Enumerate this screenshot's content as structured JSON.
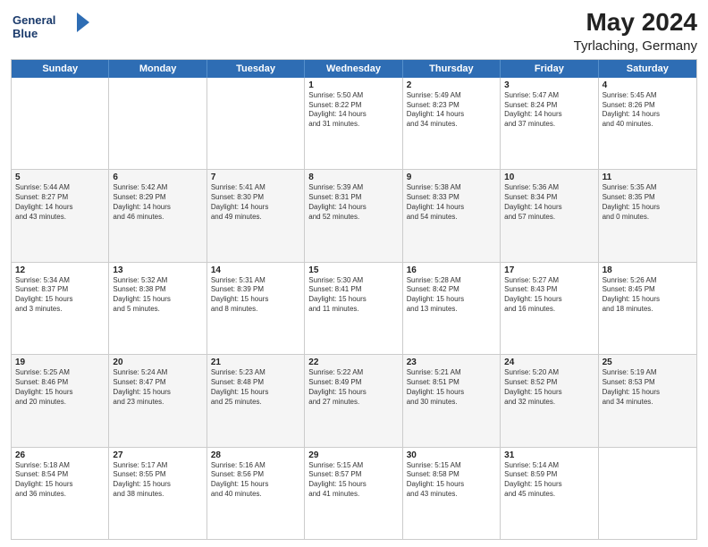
{
  "header": {
    "logo_line1": "General",
    "logo_line2": "Blue",
    "title": "May 2024",
    "subtitle": "Tyrlaching, Germany"
  },
  "calendar": {
    "days": [
      "Sunday",
      "Monday",
      "Tuesday",
      "Wednesday",
      "Thursday",
      "Friday",
      "Saturday"
    ],
    "rows": [
      [
        {
          "day": "",
          "text": ""
        },
        {
          "day": "",
          "text": ""
        },
        {
          "day": "",
          "text": ""
        },
        {
          "day": "1",
          "text": "Sunrise: 5:50 AM\nSunset: 8:22 PM\nDaylight: 14 hours\nand 31 minutes."
        },
        {
          "day": "2",
          "text": "Sunrise: 5:49 AM\nSunset: 8:23 PM\nDaylight: 14 hours\nand 34 minutes."
        },
        {
          "day": "3",
          "text": "Sunrise: 5:47 AM\nSunset: 8:24 PM\nDaylight: 14 hours\nand 37 minutes."
        },
        {
          "day": "4",
          "text": "Sunrise: 5:45 AM\nSunset: 8:26 PM\nDaylight: 14 hours\nand 40 minutes."
        }
      ],
      [
        {
          "day": "5",
          "text": "Sunrise: 5:44 AM\nSunset: 8:27 PM\nDaylight: 14 hours\nand 43 minutes."
        },
        {
          "day": "6",
          "text": "Sunrise: 5:42 AM\nSunset: 8:29 PM\nDaylight: 14 hours\nand 46 minutes."
        },
        {
          "day": "7",
          "text": "Sunrise: 5:41 AM\nSunset: 8:30 PM\nDaylight: 14 hours\nand 49 minutes."
        },
        {
          "day": "8",
          "text": "Sunrise: 5:39 AM\nSunset: 8:31 PM\nDaylight: 14 hours\nand 52 minutes."
        },
        {
          "day": "9",
          "text": "Sunrise: 5:38 AM\nSunset: 8:33 PM\nDaylight: 14 hours\nand 54 minutes."
        },
        {
          "day": "10",
          "text": "Sunrise: 5:36 AM\nSunset: 8:34 PM\nDaylight: 14 hours\nand 57 minutes."
        },
        {
          "day": "11",
          "text": "Sunrise: 5:35 AM\nSunset: 8:35 PM\nDaylight: 15 hours\nand 0 minutes."
        }
      ],
      [
        {
          "day": "12",
          "text": "Sunrise: 5:34 AM\nSunset: 8:37 PM\nDaylight: 15 hours\nand 3 minutes."
        },
        {
          "day": "13",
          "text": "Sunrise: 5:32 AM\nSunset: 8:38 PM\nDaylight: 15 hours\nand 5 minutes."
        },
        {
          "day": "14",
          "text": "Sunrise: 5:31 AM\nSunset: 8:39 PM\nDaylight: 15 hours\nand 8 minutes."
        },
        {
          "day": "15",
          "text": "Sunrise: 5:30 AM\nSunset: 8:41 PM\nDaylight: 15 hours\nand 11 minutes."
        },
        {
          "day": "16",
          "text": "Sunrise: 5:28 AM\nSunset: 8:42 PM\nDaylight: 15 hours\nand 13 minutes."
        },
        {
          "day": "17",
          "text": "Sunrise: 5:27 AM\nSunset: 8:43 PM\nDaylight: 15 hours\nand 16 minutes."
        },
        {
          "day": "18",
          "text": "Sunrise: 5:26 AM\nSunset: 8:45 PM\nDaylight: 15 hours\nand 18 minutes."
        }
      ],
      [
        {
          "day": "19",
          "text": "Sunrise: 5:25 AM\nSunset: 8:46 PM\nDaylight: 15 hours\nand 20 minutes."
        },
        {
          "day": "20",
          "text": "Sunrise: 5:24 AM\nSunset: 8:47 PM\nDaylight: 15 hours\nand 23 minutes."
        },
        {
          "day": "21",
          "text": "Sunrise: 5:23 AM\nSunset: 8:48 PM\nDaylight: 15 hours\nand 25 minutes."
        },
        {
          "day": "22",
          "text": "Sunrise: 5:22 AM\nSunset: 8:49 PM\nDaylight: 15 hours\nand 27 minutes."
        },
        {
          "day": "23",
          "text": "Sunrise: 5:21 AM\nSunset: 8:51 PM\nDaylight: 15 hours\nand 30 minutes."
        },
        {
          "day": "24",
          "text": "Sunrise: 5:20 AM\nSunset: 8:52 PM\nDaylight: 15 hours\nand 32 minutes."
        },
        {
          "day": "25",
          "text": "Sunrise: 5:19 AM\nSunset: 8:53 PM\nDaylight: 15 hours\nand 34 minutes."
        }
      ],
      [
        {
          "day": "26",
          "text": "Sunrise: 5:18 AM\nSunset: 8:54 PM\nDaylight: 15 hours\nand 36 minutes."
        },
        {
          "day": "27",
          "text": "Sunrise: 5:17 AM\nSunset: 8:55 PM\nDaylight: 15 hours\nand 38 minutes."
        },
        {
          "day": "28",
          "text": "Sunrise: 5:16 AM\nSunset: 8:56 PM\nDaylight: 15 hours\nand 40 minutes."
        },
        {
          "day": "29",
          "text": "Sunrise: 5:15 AM\nSunset: 8:57 PM\nDaylight: 15 hours\nand 41 minutes."
        },
        {
          "day": "30",
          "text": "Sunrise: 5:15 AM\nSunset: 8:58 PM\nDaylight: 15 hours\nand 43 minutes."
        },
        {
          "day": "31",
          "text": "Sunrise: 5:14 AM\nSunset: 8:59 PM\nDaylight: 15 hours\nand 45 minutes."
        },
        {
          "day": "",
          "text": ""
        }
      ]
    ]
  }
}
